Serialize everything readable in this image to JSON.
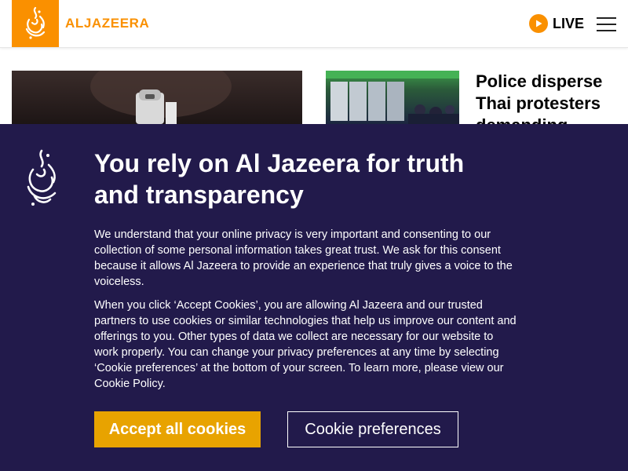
{
  "header": {
    "logo_text": "ALJAZEERA",
    "live_label": "LIVE"
  },
  "articles": {
    "thai_headline": "Police disperse Thai protesters demanding"
  },
  "cookie_banner": {
    "title": "You rely on Al Jazeera for truth and transparency",
    "paragraph1": "We understand that your online privacy is very important and consenting to our collection of some personal information takes great trust. We ask for this consent because it allows Al Jazeera to provide an experience that truly gives a voice to the voiceless.",
    "paragraph2": "When you click ‘Accept Cookies’, you are allowing Al Jazeera and our trusted partners to use cookies or similar technologies that help us improve our content and offerings to you. Other types of data we collect are necessary for our website to work properly. You can change your privacy preferences at any time by selecting ‘Cookie preferences’ at the bottom of your screen. To learn more, please view our Cookie Policy.",
    "accept_label": "Accept all cookies",
    "preferences_label": "Cookie preferences"
  },
  "colors": {
    "brand_orange": "#fa9000",
    "overlay_bg": "#221a4b",
    "accept_button": "#e8a300"
  },
  "icons": {
    "logo": "aljazeera-logo-icon",
    "live": "play-icon",
    "menu": "hamburger-menu-icon"
  }
}
